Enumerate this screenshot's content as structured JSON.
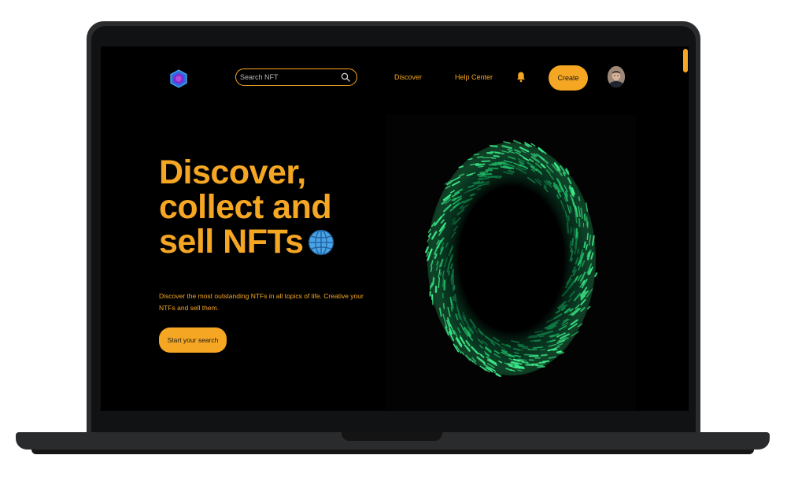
{
  "header": {
    "search": {
      "placeholder": "Search NFT",
      "value": ""
    },
    "nav": [
      {
        "label": "Discover"
      },
      {
        "label": "Help Center"
      }
    ],
    "create_label": "Create"
  },
  "hero": {
    "title_lines": [
      "Discover,",
      "collect and",
      "sell NFTs"
    ],
    "description": "Discover the most outstanding NTFs in all topics of life. Creative your NTFs and sell them.",
    "cta_label": "Start your search"
  },
  "icons": [
    "logo-icon",
    "search-icon",
    "bell-icon",
    "globe-icon",
    "avatar"
  ],
  "colors": {
    "accent": "#f5a623",
    "background": "#000000",
    "globe": "#4aa3e6",
    "sphere": "#2fd67a"
  }
}
